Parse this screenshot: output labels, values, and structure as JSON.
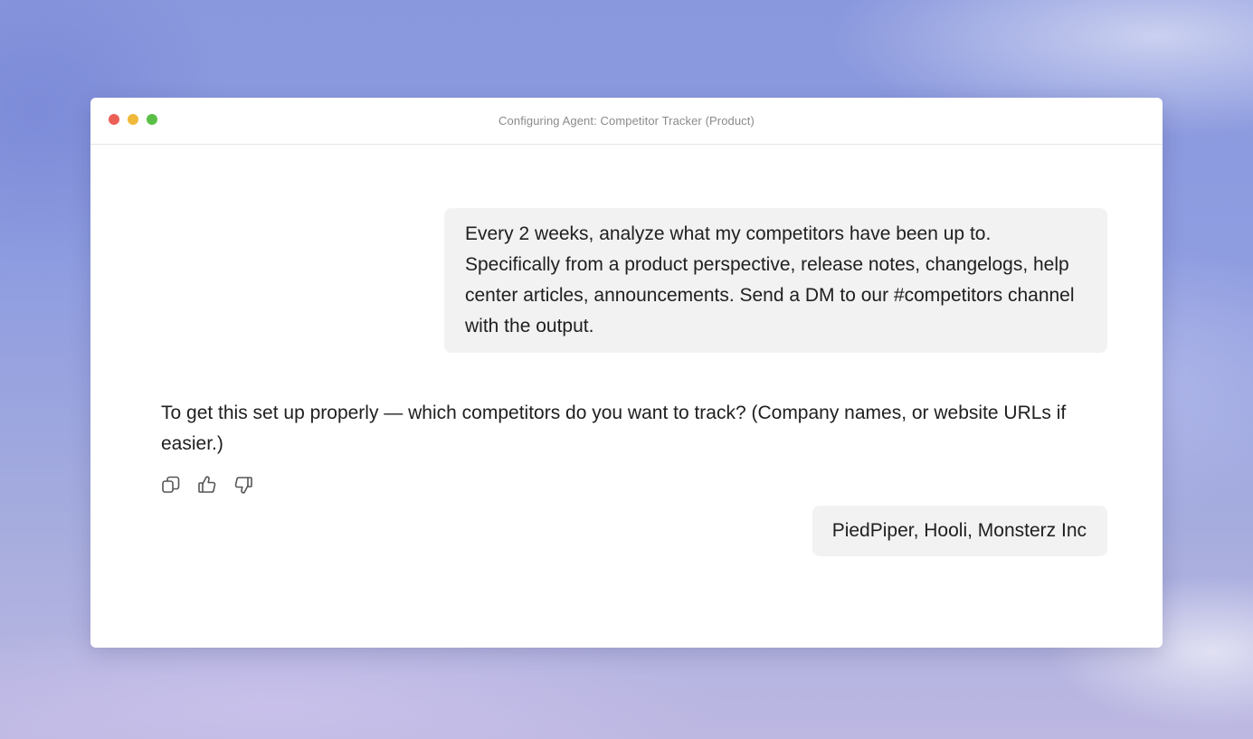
{
  "window": {
    "title": "Configuring Agent: Competitor Tracker (Product)"
  },
  "messages": {
    "user_1": "Every 2 weeks, analyze what my competitors have been up to. Specifically from a product perspective, release notes, changelogs, help center articles, announcements. Send a DM to our #competitors channel with the output.",
    "assistant_1": "To get this set up properly — which competitors do you want to track? (Company names, or website URLs if easier.)",
    "user_2": "PiedPiper, Hooli, Monsterz Inc"
  },
  "actions": {
    "icons": [
      "copy-icon",
      "thumbs-up-icon",
      "thumbs-down-icon"
    ]
  },
  "colors": {
    "traffic_close": "#ec5f57",
    "traffic_minimize": "#f0b93b",
    "traffic_maximize": "#5bbf47",
    "user_bubble": "#f2f2f2"
  }
}
